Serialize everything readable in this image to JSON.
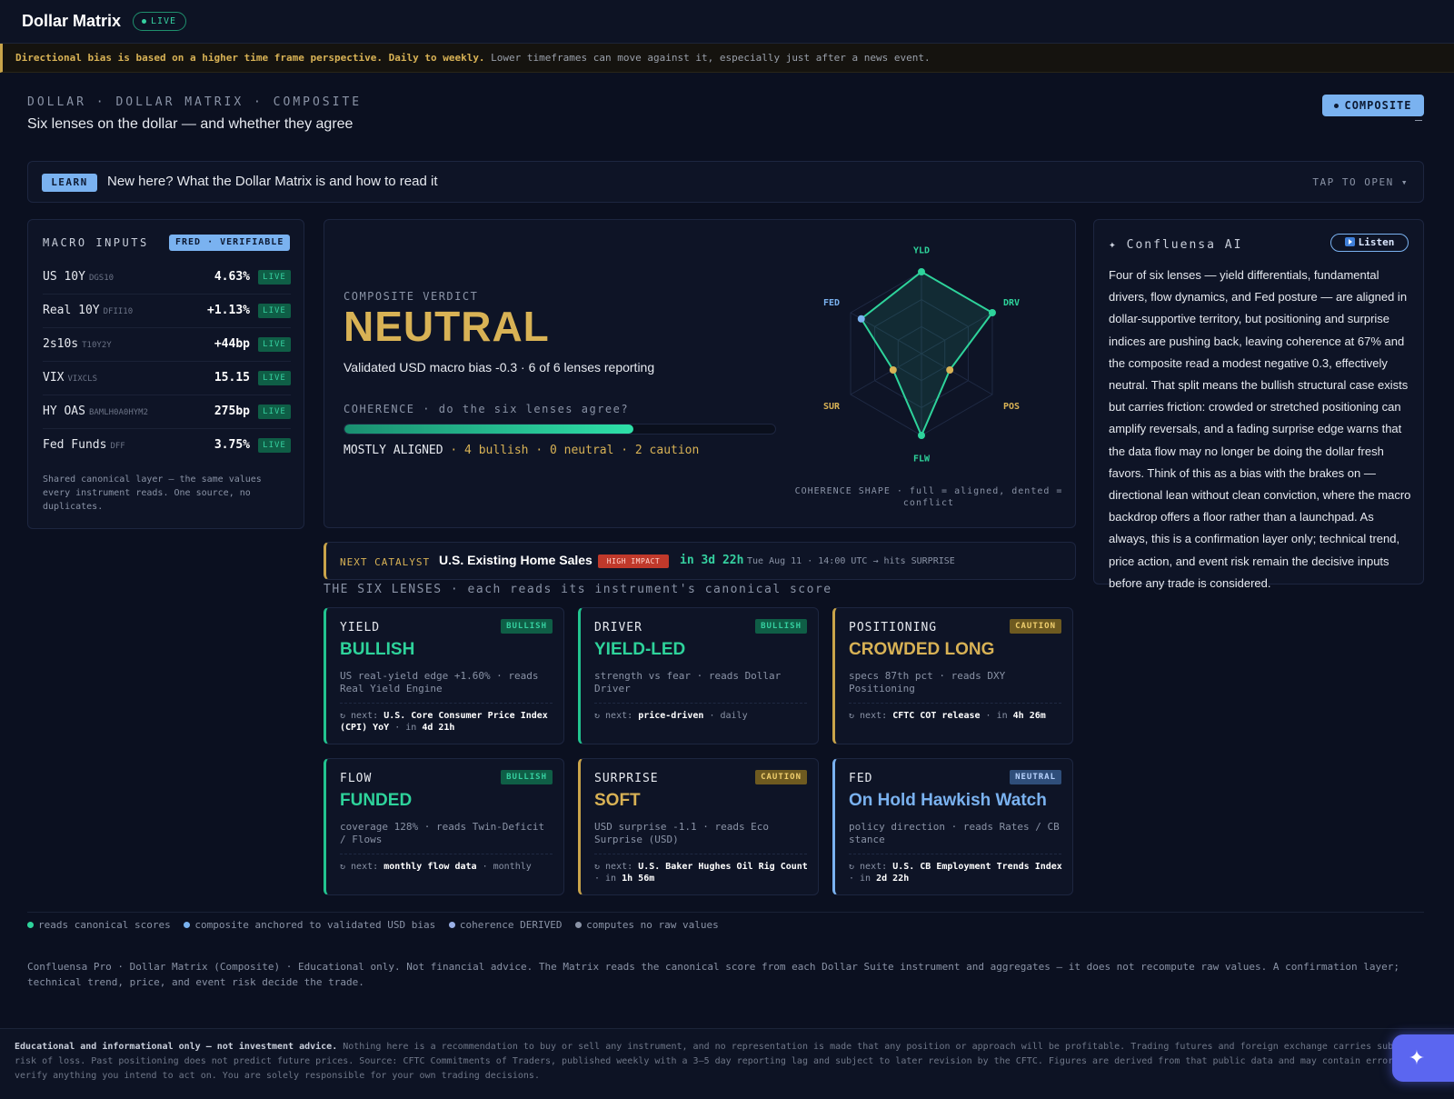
{
  "app": {
    "title": "Dollar Matrix",
    "live": "LIVE"
  },
  "notice": {
    "bold": "Directional bias is based on a higher time frame perspective. Daily to weekly.",
    "rest": " Lower timeframes can move against it, especially just after a news event."
  },
  "header": {
    "breadcrumb": "DOLLAR · DOLLAR MATRIX · COMPOSITE",
    "subtitle": "Six lenses on the dollar — and whether they agree",
    "mode_button": "COMPOSITE",
    "dash": "—"
  },
  "learn": {
    "tag": "LEARN",
    "text": "New here? What the Dollar Matrix is and how to read it",
    "action": "TAP TO OPEN ▾"
  },
  "macro": {
    "title": "MACRO INPUTS",
    "badge": "FRED · VERIFIABLE",
    "rows": [
      {
        "label": "US 10Y",
        "code": "DGS10",
        "value": "4.63%",
        "status": "LIVE"
      },
      {
        "label": "Real 10Y",
        "code": "DFII10",
        "value": "+1.13%",
        "status": "LIVE"
      },
      {
        "label": "2s10s",
        "code": "T10Y2Y",
        "value": "+44bp",
        "status": "LIVE"
      },
      {
        "label": "VIX",
        "code": "VIXCLS",
        "value": "15.15",
        "status": "LIVE"
      },
      {
        "label": "HY OAS",
        "code": "BAMLH0A0HYM2",
        "value": "275bp",
        "status": "LIVE"
      },
      {
        "label": "Fed Funds",
        "code": "DFF",
        "value": "3.75%",
        "status": "LIVE"
      }
    ],
    "footer": "Shared canonical layer — the same values every instrument reads. One source, no duplicates."
  },
  "verdict": {
    "label": "COMPOSITE VERDICT",
    "value": "NEUTRAL",
    "sub": "Validated USD macro bias -0.3 · 6 of 6 lenses reporting",
    "coherence_label": "COHERENCE · do the six lenses agree?",
    "coherence_fraction": 0.67,
    "coherence_state": "MOSTLY ALIGNED",
    "coherence_counts": "· 4 bullish · 0 neutral · 2 caution",
    "radar_caption": "COHERENCE SHAPE · full = aligned, dented = conflict",
    "radar": {
      "axes": [
        "YLD",
        "DRV",
        "POS",
        "FLW",
        "SUR",
        "FED"
      ],
      "values": [
        1.0,
        1.0,
        0.4,
        1.0,
        0.4,
        0.85
      ],
      "point_colors": [
        "#2ed39b",
        "#2ed39b",
        "#d8b255",
        "#2ed39b",
        "#d8b255",
        "#7ab2f0"
      ]
    }
  },
  "ai": {
    "title": "✦ Confluensa AI",
    "listen": "Listen",
    "body": "Four of six lenses — yield differentials, fundamental drivers, flow dynamics, and Fed posture — are aligned in dollar-supportive territory, but positioning and surprise indices are pushing back, leaving coherence at 67% and the composite read a modest negative 0.3, effectively neutral. That split means the bullish structural case exists but carries friction: crowded or stretched positioning can amplify reversals, and a fading surprise edge warns that the data flow may no longer be doing the dollar fresh favors. Think of this as a bias with the brakes on — directional lean without clean conviction, where the macro backdrop offers a floor rather than a launchpad. As always, this is a confirmation layer only; technical trend, price action, and event risk remain the decisive inputs before any trade is considered."
  },
  "catalyst": {
    "label": "NEXT CATALYST",
    "name": "U.S. Existing Home Sales",
    "impact": "HIGH IMPACT",
    "in": "in 3d 22h",
    "when": "Tue Aug 11 · 14:00 UTC → hits SURPRISE"
  },
  "lenses_title": "THE SIX LENSES · each reads its instrument's canonical score",
  "lenses": [
    {
      "name": "YIELD",
      "badge": "BULLISH",
      "verdict": "BULLISH",
      "desc": "US real-yield edge +1.60% · reads Real Yield Engine",
      "next_label": "↻ next:",
      "next_item": "U.S. Core Consumer Price Index (CPI) YoY",
      "next_sep": " · in ",
      "next_time": "4d 21h"
    },
    {
      "name": "DRIVER",
      "badge": "BULLISH",
      "verdict": "YIELD-LED",
      "desc": "strength vs fear · reads Dollar Driver",
      "next_label": "↻ next:",
      "next_item": "price-driven",
      "next_sep": " · ",
      "next_time": "daily"
    },
    {
      "name": "POSITIONING",
      "badge": "CAUTION",
      "verdict": "CROWDED LONG",
      "desc": "specs 87th pct · reads DXY Positioning",
      "next_label": "↻ next:",
      "next_item": "CFTC COT release",
      "next_sep": " · in ",
      "next_time": "4h 26m"
    },
    {
      "name": "FLOW",
      "badge": "BULLISH",
      "verdict": "FUNDED",
      "desc": "coverage 128% · reads Twin-Deficit / Flows",
      "next_label": "↻ next:",
      "next_item": "monthly flow data",
      "next_sep": " · ",
      "next_time": "monthly"
    },
    {
      "name": "SURPRISE",
      "badge": "CAUTION",
      "verdict": "SOFT",
      "desc": "USD surprise -1.1 · reads Eco Surprise (USD)",
      "next_label": "↻ next:",
      "next_item": "U.S. Baker Hughes Oil Rig Count",
      "next_sep": " · in ",
      "next_time": "1h 56m"
    },
    {
      "name": "FED",
      "badge": "NEUTRAL",
      "verdict": "On Hold Hawkish Watch",
      "desc": "policy direction · reads Rates / CB stance",
      "next_label": "↻ next:",
      "next_item": "U.S. CB Employment Trends Index",
      "next_sep": " · in ",
      "next_time": "2d 22h"
    }
  ],
  "legend": [
    "reads canonical scores",
    "composite anchored to validated USD bias",
    "coherence DERIVED",
    "computes no raw values"
  ],
  "footnote": "Confluensa Pro · Dollar Matrix (Composite) · Educational only. Not financial advice. The Matrix reads the canonical score from each Dollar Suite instrument and aggregates — it does not recompute raw values. A confirmation layer; technical trend, price, and event risk decide the trade.",
  "disclaimer": {
    "bold": "Educational and informational only — not investment advice.",
    "rest": " Nothing here is a recommendation to buy or sell any instrument, and no representation is made that any position or approach will be profitable. Trading futures and foreign exchange carries substantial risk of loss. Past positioning does not predict future prices. Source: CFTC Commitments of Traders, published weekly with a 3–5 day reporting lag and subject to later revision by the CFTC. Figures are derived from that public data and may contain errors — verify anything you intend to act on. You are solely responsible for your own trading decisions."
  },
  "fab_icon": "✦"
}
